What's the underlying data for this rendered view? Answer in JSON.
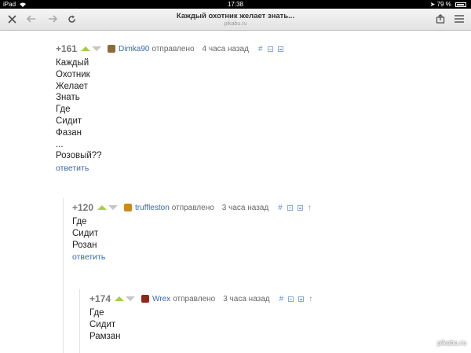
{
  "status": {
    "device": "iPad",
    "time": "17:38",
    "battery": "79 %"
  },
  "browser": {
    "title": "Каждый охотник желает знать...",
    "url": "pikabu.ru"
  },
  "comments": [
    {
      "rating": "+161",
      "user": "Dimka90",
      "verb": "отправлено",
      "time": "4 часа назад",
      "lines": [
        "Каждый",
        "Охотник",
        "Желает",
        "Знать",
        "Где",
        "Сидит",
        "Фазан",
        "...",
        "Розовый??"
      ],
      "reply": "ответить",
      "avatar_color": "#8a6b3a"
    },
    {
      "rating": "+120",
      "user": "truffleston",
      "verb": "отправлено",
      "time": "3 часа назад",
      "lines": [
        "Где",
        "Сидит",
        "Розан"
      ],
      "reply": "ответить",
      "avatar_color": "#c98a1e"
    },
    {
      "rating": "+174",
      "user": "Wrex",
      "verb": "отправлено",
      "time": "3 часа назад",
      "lines": [
        "Где",
        "Сидит",
        "Рамзан"
      ],
      "avatar_color": "#8b2a1a"
    }
  ],
  "actions": {
    "hash": "#",
    "up": "↑"
  },
  "watermark": "pikabu.ru"
}
